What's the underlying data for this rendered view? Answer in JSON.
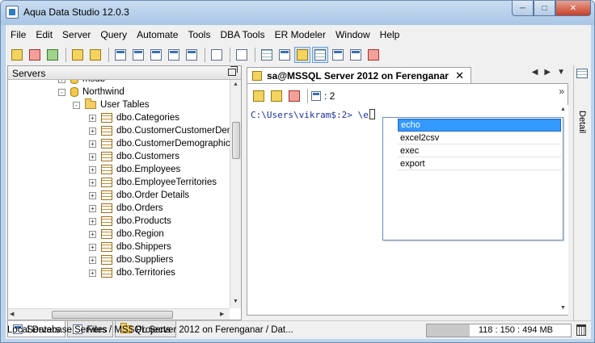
{
  "window": {
    "title": "Aqua Data Studio 12.0.3"
  },
  "menu": [
    "File",
    "Edit",
    "Server",
    "Query",
    "Automate",
    "Tools",
    "DBA Tools",
    "ER Modeler",
    "Window",
    "Help"
  ],
  "left_panel": {
    "title": "Servers",
    "tree": [
      {
        "label": "msdb",
        "level": 2,
        "icon": "database-icon",
        "expander": "+"
      },
      {
        "label": "Northwind",
        "level": 2,
        "icon": "database-icon",
        "expander": "-"
      },
      {
        "label": "User Tables",
        "level": 3,
        "icon": "folder-icon",
        "expander": "-"
      },
      {
        "label": "dbo.Categories",
        "level": 4,
        "icon": "table-icon",
        "expander": "+"
      },
      {
        "label": "dbo.CustomerCustomerDem",
        "level": 4,
        "icon": "table-icon",
        "expander": "+"
      },
      {
        "label": "dbo.CustomerDemographics",
        "level": 4,
        "icon": "table-icon",
        "expander": "+"
      },
      {
        "label": "dbo.Customers",
        "level": 4,
        "icon": "table-icon",
        "expander": "+"
      },
      {
        "label": "dbo.Employees",
        "level": 4,
        "icon": "table-icon",
        "expander": "+"
      },
      {
        "label": "dbo.EmployeeTerritories",
        "level": 4,
        "icon": "table-icon",
        "expander": "+"
      },
      {
        "label": "dbo.Order Details",
        "level": 4,
        "icon": "table-icon",
        "expander": "+"
      },
      {
        "label": "dbo.Orders",
        "level": 4,
        "icon": "table-icon",
        "expander": "+"
      },
      {
        "label": "dbo.Products",
        "level": 4,
        "icon": "table-icon",
        "expander": "+"
      },
      {
        "label": "dbo.Region",
        "level": 4,
        "icon": "table-icon",
        "expander": "+"
      },
      {
        "label": "dbo.Shippers",
        "level": 4,
        "icon": "table-icon",
        "expander": "+"
      },
      {
        "label": "dbo.Suppliers",
        "level": 4,
        "icon": "table-icon",
        "expander": "+"
      },
      {
        "label": "dbo.Territories",
        "level": 4,
        "icon": "table-icon",
        "expander": "+"
      }
    ],
    "tabs": [
      {
        "label": "Servers",
        "icon": "servers-icon",
        "active": true
      },
      {
        "label": "Files",
        "icon": "files-icon",
        "active": false
      },
      {
        "label": "Projects",
        "icon": "projects-icon",
        "active": false
      }
    ]
  },
  "editor": {
    "tab_label": "sa@MSSQL Server 2012 on Ferenganar",
    "page_count": ": 2",
    "prompt": "C:\\Users\\vikram$:2> \\e",
    "completions": [
      "echo",
      "excel2csv",
      "exec",
      "export"
    ],
    "selected_completion": 0
  },
  "detail_panel": {
    "label": "Detail"
  },
  "status": {
    "path": "Local Database Servers / MSSQL Server 2012 on Ferenganar / Dat...",
    "memory": "118 : 150 : 494 MB",
    "memory_fraction": 0.3
  }
}
